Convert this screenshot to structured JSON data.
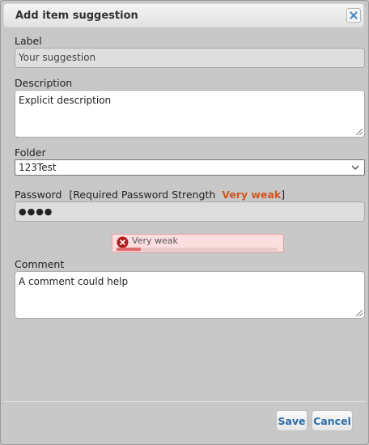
{
  "dialog": {
    "title": "Add item suggestion",
    "close_icon": "close-icon"
  },
  "form": {
    "label": {
      "caption": "Label",
      "placeholder": "Your suggestion"
    },
    "description": {
      "caption": "Description",
      "value": "Explicit description"
    },
    "folder": {
      "caption": "Folder",
      "selected": "123Test"
    },
    "password": {
      "caption": "Password",
      "required_prefix": "[Required Password Strength",
      "required_level": "Very weak",
      "required_suffix": "]",
      "value": "●●●●",
      "strength_text": "Very weak",
      "strength_fraction": 0.15,
      "strength_icon": "error-x-icon"
    },
    "comment": {
      "caption": "Comment",
      "value": "A comment could help"
    }
  },
  "buttons": {
    "save": "Save",
    "cancel": "Cancel"
  },
  "colors": {
    "accent": "#2b6ea8",
    "weak": "#d2551f",
    "error_icon": "#b01c1c",
    "meter_fill": "#e06a6a",
    "strength_bg": "#fddede"
  }
}
